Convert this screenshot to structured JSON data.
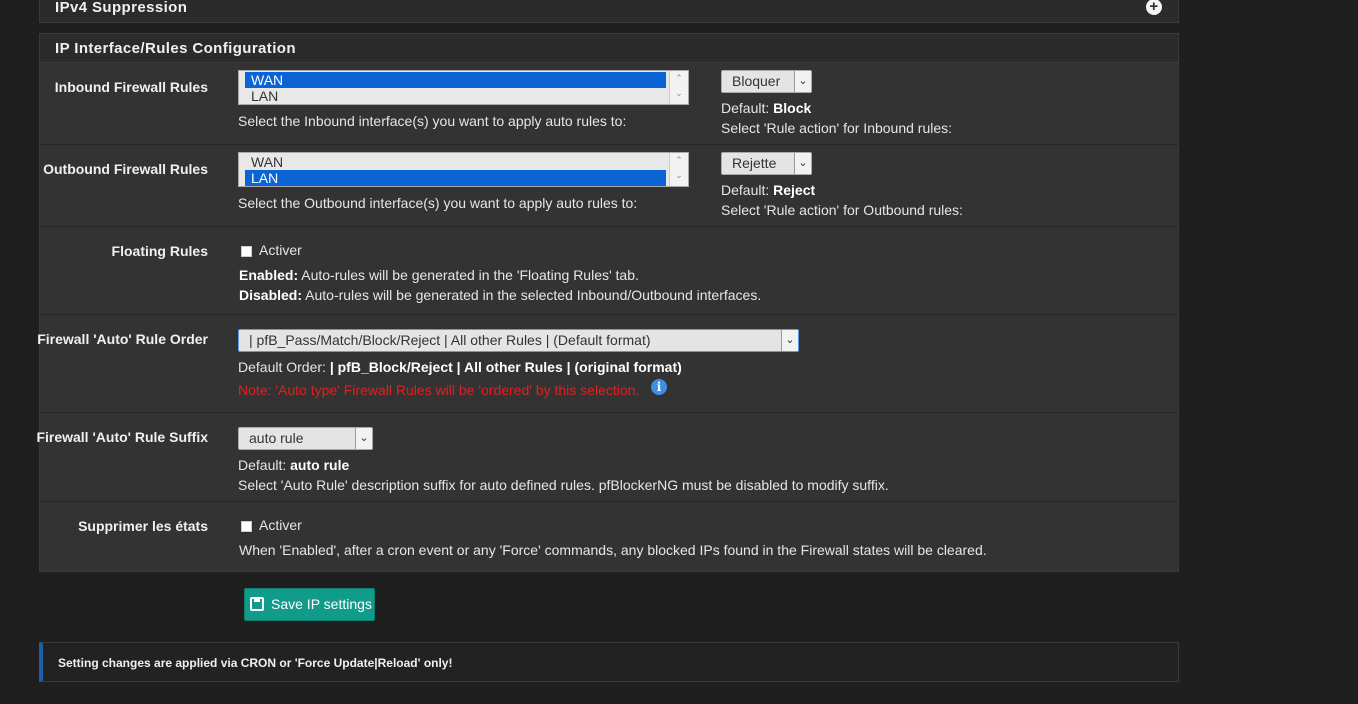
{
  "ipv4_panel": {
    "title": "IPv4 Suppression",
    "toggle_icon": "plus-circle-icon"
  },
  "config_panel": {
    "title": "IP Interface/Rules Configuration"
  },
  "inbound": {
    "label": "Inbound Firewall Rules",
    "interfaces": [
      {
        "name": "WAN",
        "selected": true
      },
      {
        "name": "LAN",
        "selected": false
      }
    ],
    "help": "Select the Inbound interface(s) you want to apply auto rules to:",
    "action_value": "Bloquer",
    "default_prefix": "Default:",
    "default_value": "Block",
    "action_help": "Select 'Rule action' for Inbound rules:"
  },
  "outbound": {
    "label": "Outbound Firewall Rules",
    "interfaces": [
      {
        "name": "WAN",
        "selected": false
      },
      {
        "name": "LAN",
        "selected": true
      }
    ],
    "help": "Select the Outbound interface(s) you want to apply auto rules to:",
    "action_value": "Rejette",
    "default_prefix": "Default:",
    "default_value": "Reject",
    "action_help": "Select 'Rule action' for Outbound rules:"
  },
  "floating": {
    "label": "Floating Rules",
    "checkbox_label": "Activer",
    "checked": false,
    "enabled_prefix": "Enabled:",
    "enabled_text": "Auto-rules will be generated in the 'Floating Rules' tab.",
    "disabled_prefix": "Disabled:",
    "disabled_text": "Auto-rules will be generated in the selected Inbound/Outbound interfaces."
  },
  "rule_order": {
    "label": "Firewall 'Auto' Rule Order",
    "value": "| pfB_Pass/Match/Block/Reject | All other Rules | (Default format)",
    "default_prefix": "Default Order:",
    "default_value": "| pfB_Block/Reject | All other Rules | (original format)",
    "note": "Note: 'Auto type' Firewall Rules will be 'ordered' by this selection."
  },
  "rule_suffix": {
    "label": "Firewall 'Auto' Rule Suffix",
    "value": "auto rule",
    "default_prefix": "Default:",
    "default_value": "auto rule",
    "help": "Select 'Auto Rule' description suffix for auto defined rules. pfBlockerNG must be disabled to modify suffix."
  },
  "kill_states": {
    "label": "Supprimer les états",
    "checkbox_label": "Activer",
    "checked": false,
    "help": "When 'Enabled', after a cron event or any 'Force' commands, any blocked IPs found in the Firewall states will be cleared."
  },
  "save_button": {
    "label": "Save IP settings",
    "icon": "save-disk-icon",
    "color": "#119b8a"
  },
  "alert": {
    "text": "Setting changes are applied via CRON or 'Force Update|Reload' only!",
    "accent": "#1d5fa8"
  }
}
